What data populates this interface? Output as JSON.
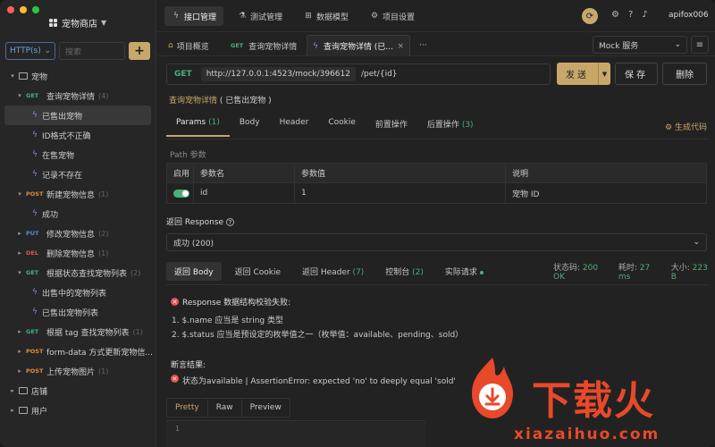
{
  "sidebar": {
    "project_title": "宠物商店",
    "method_filter": "HTTP(s)",
    "search_placeholder": "搜索",
    "tree": [
      {
        "type": "folder",
        "label": "宠物",
        "indent": 1,
        "expanded": true
      },
      {
        "type": "api",
        "method": "GET",
        "label": "查询宠物详情",
        "count": "(4)",
        "indent": 2,
        "expanded": true
      },
      {
        "type": "case",
        "label": "已售出宠物",
        "indent": 3,
        "active": true
      },
      {
        "type": "case",
        "label": "ID格式不正确",
        "indent": 3
      },
      {
        "type": "case",
        "label": "在售宠物",
        "indent": 3
      },
      {
        "type": "case",
        "label": "记录不存在",
        "indent": 3
      },
      {
        "type": "api",
        "method": "POST",
        "label": "新建宠物信息",
        "count": "(1)",
        "indent": 2,
        "expanded": true
      },
      {
        "type": "case",
        "label": "成功",
        "indent": 3
      },
      {
        "type": "api",
        "method": "PUT",
        "label": "修改宠物信息",
        "count": "(2)",
        "indent": 2
      },
      {
        "type": "api",
        "method": "DEL",
        "label": "删除宠物信息",
        "count": "(1)",
        "indent": 2
      },
      {
        "type": "api",
        "method": "GET",
        "label": "根据状态查找宠物列表",
        "count": "(2)",
        "indent": 2,
        "expanded": true
      },
      {
        "type": "case",
        "label": "出售中的宠物列表",
        "indent": 3
      },
      {
        "type": "case",
        "label": "已售出宠物列表",
        "indent": 3
      },
      {
        "type": "api",
        "method": "GET",
        "label": "根据 tag 查找宠物列表",
        "count": "(1)",
        "indent": 2
      },
      {
        "type": "api",
        "method": "POST",
        "label": "form-data 方式更新宠物信...",
        "count": "",
        "indent": 2
      },
      {
        "type": "api",
        "method": "POST",
        "label": "上传宠物图片",
        "count": "(1)",
        "indent": 2
      },
      {
        "type": "folder",
        "label": "店铺",
        "indent": 1
      },
      {
        "type": "folder",
        "label": "用户",
        "indent": 1
      }
    ]
  },
  "topnav": {
    "tabs": [
      "接口管理",
      "测试管理",
      "数据模型",
      "项目设置"
    ],
    "username": "apifox006"
  },
  "doc_tabs": [
    {
      "label": "项目概览",
      "prefix": ""
    },
    {
      "label": "查询宠物详情",
      "prefix": "GET"
    },
    {
      "label": "查询宠物详情 (已...",
      "prefix": ""
    }
  ],
  "more_tabs": "···",
  "mock_service": "Mock 服务",
  "request": {
    "method": "GET",
    "base_url": "http://127.0.0.1:4523/mock/396612",
    "path": "/pet/{id}",
    "send": "发送",
    "save": "保存",
    "delete": "删除"
  },
  "breadcrumb": {
    "link": "查询宠物详情",
    "tail": "( 已售出宠物 )"
  },
  "param_tabs": [
    {
      "label": "Params",
      "count": "(1)"
    },
    {
      "label": "Body",
      "count": ""
    },
    {
      "label": "Header",
      "count": ""
    },
    {
      "label": "Cookie",
      "count": ""
    },
    {
      "label": "前置操作",
      "count": ""
    },
    {
      "label": "后置操作",
      "count": "(3)"
    }
  ],
  "generate_code": "生成代码",
  "path_params_label": "Path 参数",
  "params_table": {
    "headers": [
      "启用",
      "参数名",
      "参数值",
      "说明"
    ],
    "rows": [
      {
        "enabled": true,
        "name": "id",
        "value": "1",
        "desc": "宠物 ID"
      }
    ]
  },
  "response": {
    "label": "返回 Response",
    "selected": "成功 (200)",
    "tabs": [
      {
        "label": "返回 Body",
        "count": ""
      },
      {
        "label": "返回 Cookie",
        "count": ""
      },
      {
        "label": "返回 Header",
        "count": "(7)"
      },
      {
        "label": "控制台",
        "count": "(2)"
      },
      {
        "label": "实际请求",
        "count": ""
      }
    ],
    "status_label": "状态码:",
    "status_value": "200 OK",
    "time_label": "耗时:",
    "time_value": "27 ms",
    "size_label": "大小:",
    "size_value": "223 B",
    "error_title": "Response 数据结构校验失败:",
    "errors": [
      "1. $.name 应当是 string 类型",
      "2. $.status 应当是预设定的枚举值之一（枚举值：available、pending、sold）"
    ],
    "assert_label": "断言结果:",
    "assert_line": "状态为available | AssertionError: expected 'no' to deeply equal 'sold'",
    "body_tabs": [
      "Pretty",
      "Raw",
      "Preview"
    ],
    "editor_line": "1"
  },
  "watermark": {
    "text": "下载火",
    "domain": "xiazaihuo.com"
  }
}
